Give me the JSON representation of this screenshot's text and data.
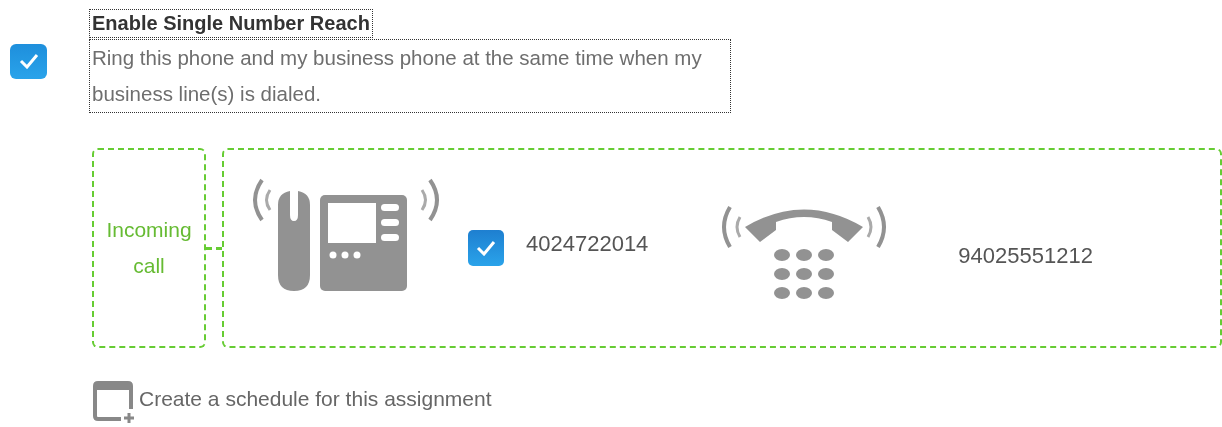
{
  "single_number_reach": {
    "checked": true,
    "title": "Enable Single Number Reach",
    "description": "Ring this phone and my business phone at the same time when my business line(s) is dialed."
  },
  "incoming": {
    "label": "Incoming call"
  },
  "devices": [
    {
      "kind": "desk",
      "checked": true,
      "number": "4024722014"
    },
    {
      "kind": "handset",
      "number": "94025551212"
    }
  ],
  "schedule_link": {
    "label": "Create a schedule for this assignment"
  }
}
